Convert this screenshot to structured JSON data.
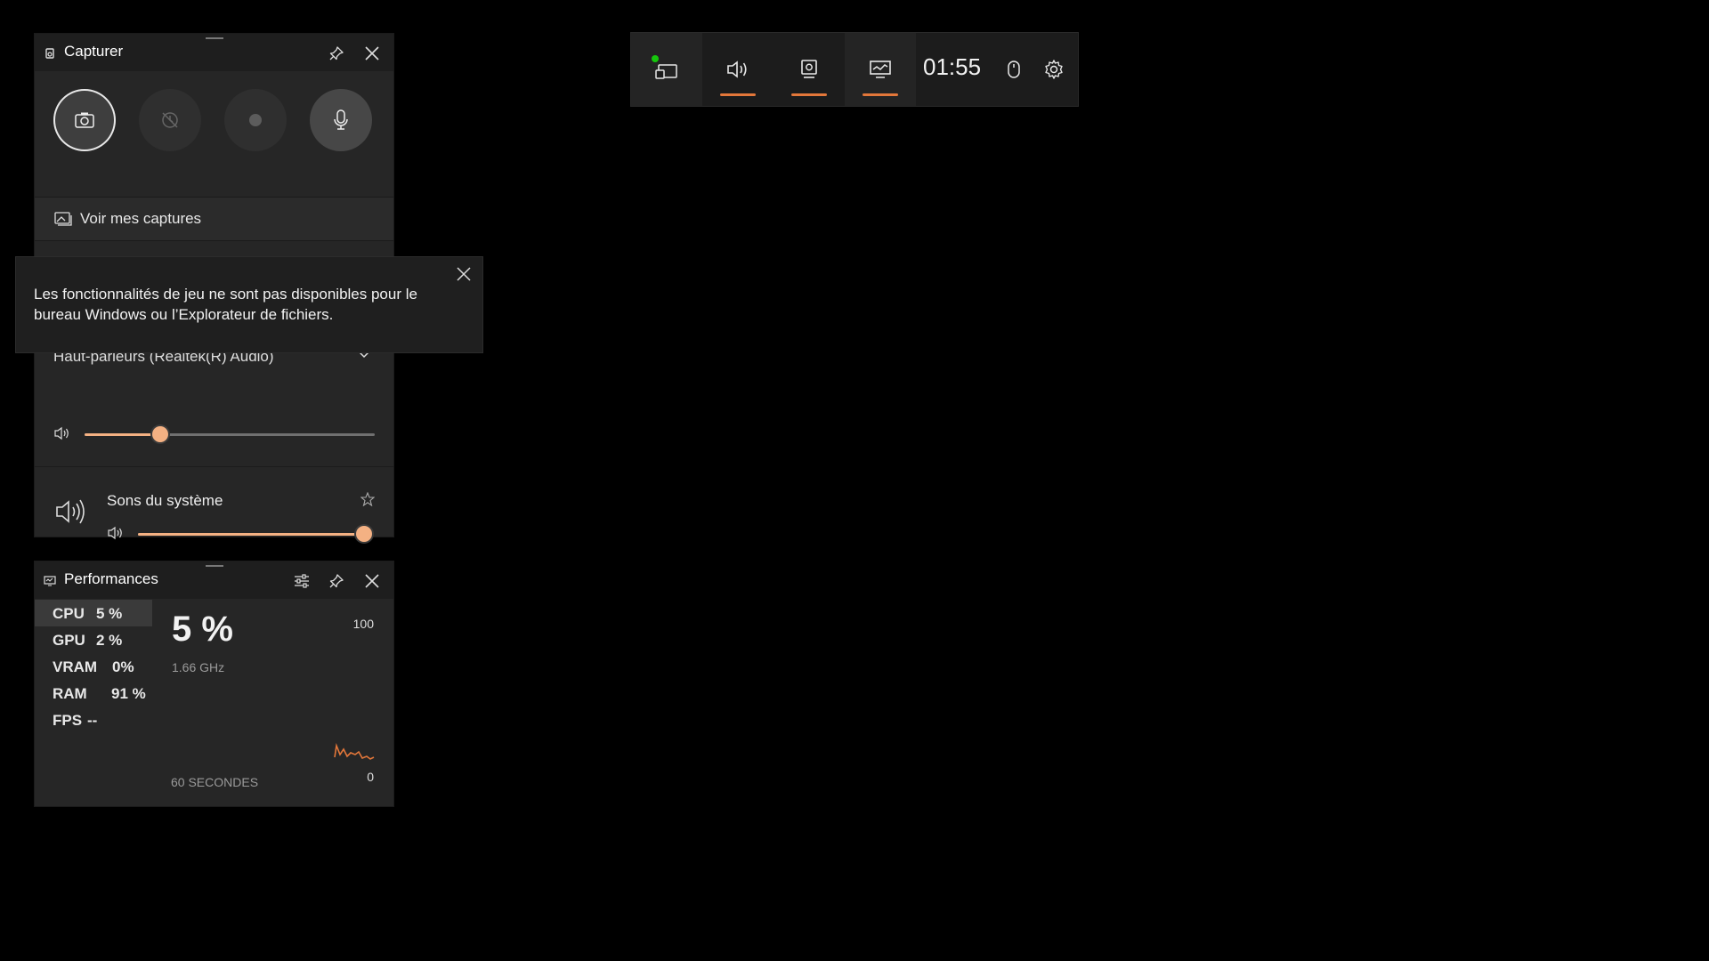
{
  "capture_widget": {
    "title": "Capturer",
    "see_captures_label": "Voir mes captures",
    "buttons": [
      {
        "name": "screenshot",
        "icon": "camera-icon"
      },
      {
        "name": "record-last-30s",
        "icon": "record-history-icon"
      },
      {
        "name": "start-recording",
        "icon": "record-dot-icon"
      },
      {
        "name": "microphone",
        "icon": "microphone-icon"
      }
    ]
  },
  "audio": {
    "device_label": "Haut-parleurs (Realtek(R) Audio)",
    "device_volume": 0.26,
    "system_sounds_label": "Sons du système",
    "system_sounds_volume": 1.0,
    "accent_color": "#f4b183"
  },
  "toast": {
    "message": "Les fonctionnalités de jeu ne sont pas disponibles pour le bureau Windows ou l’Explorateur de fichiers."
  },
  "performance": {
    "title": "Performances",
    "metrics": [
      {
        "key": "CPU",
        "value": "5 %"
      },
      {
        "key": "GPU",
        "value": "2 %"
      },
      {
        "key": "VRAM",
        "value": "0%"
      },
      {
        "key": "RAM",
        "value": "91 %"
      },
      {
        "key": "FPS",
        "value": "--"
      }
    ],
    "selected": "CPU",
    "big_value": "5 %",
    "frequency": "1.66 GHz",
    "graph_max": "100",
    "graph_min": "0",
    "duration_label": "60 SECONDES",
    "graph_color": "#e3773a"
  },
  "top_bar": {
    "time": "01:55",
    "underline_color": "#e3773a",
    "status_color": "#16c60c",
    "buttons": [
      "widget-menu-icon",
      "audio-icon",
      "capture-icon",
      "performance-icon",
      "mouse-icon",
      "settings-icon"
    ]
  }
}
